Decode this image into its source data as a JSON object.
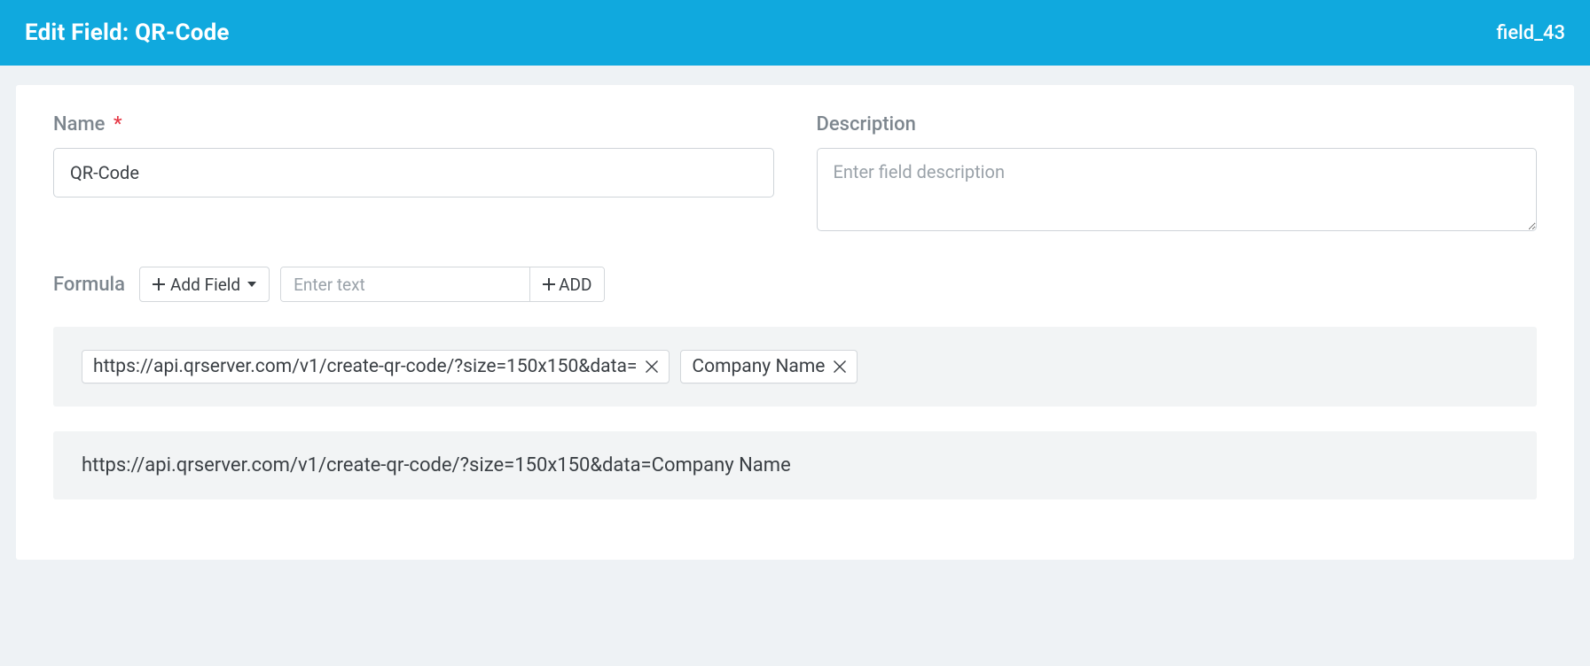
{
  "header": {
    "title_prefix": "Edit Field: ",
    "title_name": "QR-Code",
    "field_id": "field_43"
  },
  "form": {
    "name_label": "Name",
    "name_value": "QR-Code",
    "description_label": "Description",
    "description_placeholder": "Enter field description",
    "description_value": ""
  },
  "formula": {
    "label": "Formula",
    "add_field_label": "Add Field",
    "text_placeholder": "Enter text",
    "add_button_label": "ADD",
    "tokens": [
      {
        "type": "text",
        "value": "https://api.qrserver.com/v1/create-qr-code/?size=150x150&data="
      },
      {
        "type": "field",
        "value": "Company Name"
      }
    ],
    "preview": "https://api.qrserver.com/v1/create-qr-code/?size=150x150&data=Company Name"
  }
}
